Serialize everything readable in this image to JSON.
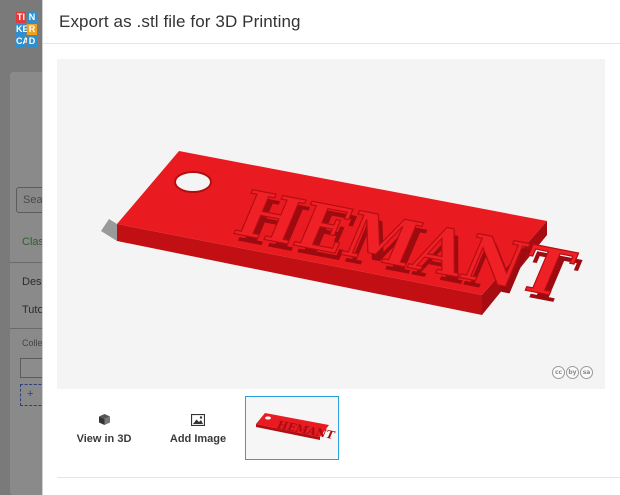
{
  "background": {
    "logo_letters": [
      "TI",
      "N",
      "",
      "KE",
      "R",
      "",
      "CA",
      "D",
      ""
    ],
    "search_placeholder": "Sea",
    "items": [
      "Clas",
      "Des",
      "Tuto",
      "Colle"
    ],
    "add_label": "+ "
  },
  "modal": {
    "title": "Export as .stl file for 3D Printing",
    "preview_text": "HEMANT",
    "license_icons": [
      "cc",
      "by",
      "sa"
    ],
    "thumbnails": [
      {
        "icon": "cube-icon",
        "label": "View in 3D"
      },
      {
        "icon": "image-icon",
        "label": "Add Image"
      },
      {
        "icon": "",
        "label": ""
      }
    ]
  },
  "colors": {
    "object_red": "#e8161c",
    "selection_blue": "#29a0d8"
  }
}
